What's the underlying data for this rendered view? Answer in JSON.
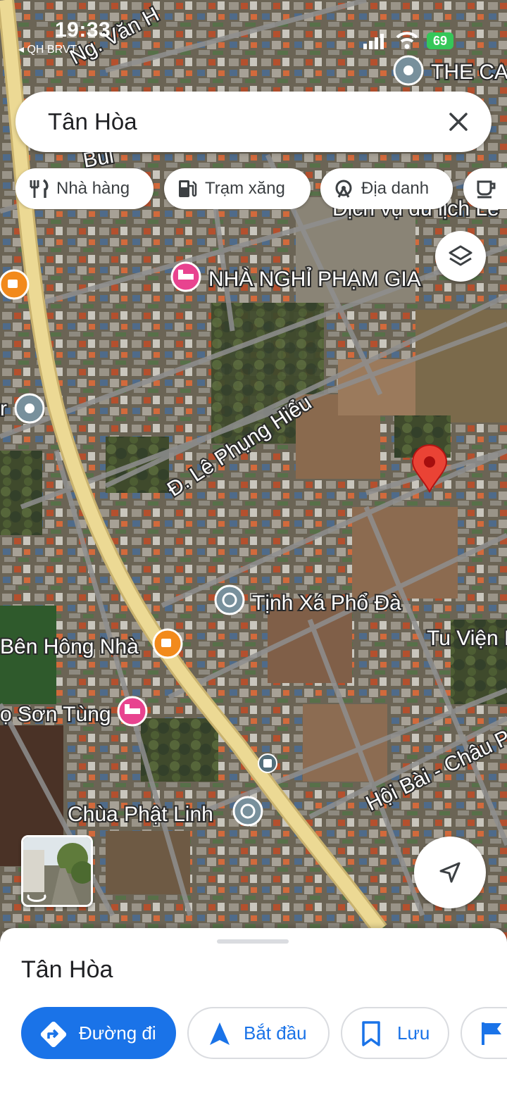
{
  "status_bar": {
    "time": "19:33",
    "back_label": "◂ QH BRVT",
    "battery": "69"
  },
  "search": {
    "query": "Tân Hòa"
  },
  "chips": [
    {
      "label": "Nhà hàng",
      "icon": "restaurant-icon"
    },
    {
      "label": "Trạm xăng",
      "icon": "gas-station-icon"
    },
    {
      "label": "Địa danh",
      "icon": "landmark-icon"
    },
    {
      "label": "",
      "icon": "coffee-icon"
    }
  ],
  "map_labels": {
    "nguyen_hue": "Ng. Văn H",
    "the_ca": "THE CA",
    "bui": "Bùi",
    "dich_vu": "Dịch vụ du lịch Lê",
    "nha_nghi": "NHÀ NGHỈ PHẠM GIA",
    "le_phung_hieu": "Đ. Lê Phụng Hiểu",
    "r_place": "r",
    "tinh_xa": "Tịnh Xá Phổ Đà",
    "ben_hong_nha": "Bên Hông Nhà",
    "tu_vien": "Tu Viện P",
    "son_tung": "ọ Sơn Tùng",
    "hoi_bai": "Hội Bài - Châu P",
    "chua_phat_linh": "Chùa Phật Linh"
  },
  "colors": {
    "accent": "#1a73e8",
    "pin": "#ea4335",
    "lodging": "#e8438f",
    "cafe": "#f28a1c",
    "poi_gray": "#78909c",
    "highway": "#e8d28c"
  },
  "place_sheet": {
    "title": "Tân Hòa",
    "actions": [
      {
        "label": "Đường đi",
        "icon": "directions-icon"
      },
      {
        "label": "Bắt đầu",
        "icon": "navigation-arrow-icon"
      },
      {
        "label": "Lưu",
        "icon": "bookmark-icon"
      },
      {
        "label": "",
        "icon": "flag-icon"
      }
    ]
  }
}
